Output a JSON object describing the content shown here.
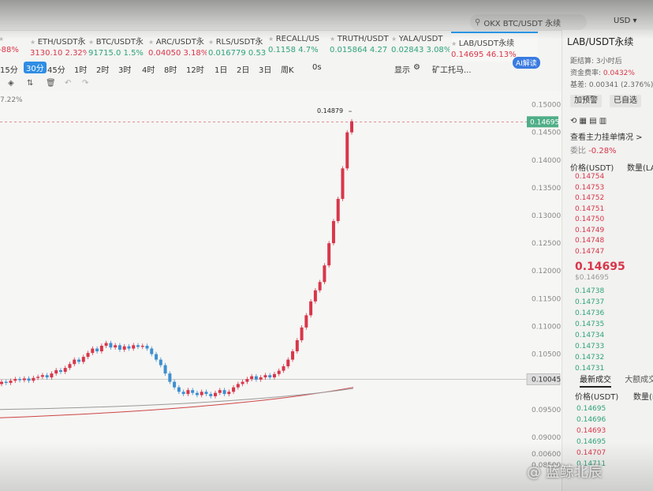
{
  "search": {
    "placeholder": "OKX BTC/USDT 永续"
  },
  "currency": "USD",
  "tickers": [
    {
      "name": "",
      "price": "",
      "change": "-88%",
      "dir": "dn"
    },
    {
      "name": "ETH/USDT永",
      "price": "3130.10",
      "change": "2.32%",
      "dir": "dn"
    },
    {
      "name": "BTC/USDT永",
      "price": "91715.0",
      "change": "1.5%",
      "dir": "up"
    },
    {
      "name": "ARC/USDT永",
      "price": "0.04050",
      "change": "3.18%",
      "dir": "dn"
    },
    {
      "name": "RLS/USDT永",
      "price": "0.016779",
      "change": "0.53",
      "dir": "up"
    },
    {
      "name": "RECALL/US",
      "price": "0.1158",
      "change": "4.7%",
      "dir": "up"
    },
    {
      "name": "TRUTH/USDT",
      "price": "0.015864",
      "change": "4.27",
      "dir": "up"
    },
    {
      "name": "YALA/USDT",
      "price": "0.02843",
      "change": "3.08%",
      "dir": "up"
    },
    {
      "name": "LAB/USDT永续",
      "price": "0.14695",
      "change": "46.13%",
      "dir": "dn"
    }
  ],
  "timeframes": [
    "15分",
    "30分",
    "45分",
    "1时",
    "2时",
    "3时",
    "4时",
    "8时",
    "12时",
    "1日",
    "2日",
    "3日",
    "周K",
    "0s"
  ],
  "selected_timeframe": "30分",
  "display_label": "显示",
  "miner_label": "矿工托马...",
  "ai_badge": "AI解读",
  "chart_change_pct": "7.22%",
  "panel": {
    "title": "LAB/USDT永续",
    "countdown_label": "距结算:",
    "countdown_value": "3小时后",
    "funding_label": "资金费率:",
    "funding_value": "0.0432%",
    "basis_label": "基差:",
    "basis_value": "0.00341 (2.376%)",
    "alert_btn": "加预警",
    "fav_btn": "已自选",
    "depth_link": "查看主力挂单情况 >",
    "ratio_label": "委比",
    "ratio_value": "-0.28%",
    "col_price": "价格(USDT)",
    "col_qty": "数量(LA",
    "asks": [
      "0.14754",
      "0.14753",
      "0.14752",
      "0.14751",
      "0.14750",
      "0.14749",
      "0.14748",
      "0.14747"
    ],
    "last_price": "0.14695",
    "last_usd": "$0.14695",
    "bids": [
      "0.14738",
      "0.14737",
      "0.14736",
      "0.14735",
      "0.14734",
      "0.14733",
      "0.14732",
      "0.14731"
    ],
    "tab_latest": "最新成交",
    "tab_large": "大额成交",
    "trades_col_price": "价格(USDT)",
    "trades_col_qty": "数量(L",
    "trades": [
      {
        "p": "0.14695",
        "dir": "up"
      },
      {
        "p": "0.14696",
        "dir": "up"
      },
      {
        "p": "0.14693",
        "dir": "dn"
      },
      {
        "p": "0.14695",
        "dir": "up"
      },
      {
        "p": "0.14707",
        "dir": "dn"
      },
      {
        "p": "0.14711",
        "dir": "up"
      }
    ]
  },
  "watermark": "@ 蓝鲸北辰",
  "colors": {
    "up": "#2fa37d",
    "down": "#d8364a",
    "accent": "#2f8de4"
  },
  "chart_data": {
    "type": "candlestick",
    "y_ticks": [
      0.15,
      0.145,
      0.14,
      0.135,
      0.13,
      0.125,
      0.12,
      0.115,
      0.11,
      0.105,
      0.1,
      0.095,
      0.09,
      0.085,
      0.006
    ],
    "y_tick_labels": [
      "0.15000",
      "0.14500",
      "0.14000",
      "0.13500",
      "0.13000",
      "0.12500",
      "0.12000",
      "0.11500",
      "0.11000",
      "0.10500",
      "0.10045",
      "0.09500",
      "0.09000",
      "0.08500",
      "0.00600"
    ],
    "ylim": [
      0.081,
      0.153
    ],
    "last_price_label": "0.14695",
    "ref_line_label": "0.10045",
    "high_label": "0.14879",
    "closes": [
      0.1,
      0.0998,
      0.1002,
      0.1005,
      0.1003,
      0.1006,
      0.1002,
      0.1007,
      0.1009,
      0.1012,
      0.1008,
      0.1015,
      0.1021,
      0.1018,
      0.1025,
      0.1032,
      0.104,
      0.1036,
      0.1045,
      0.1052,
      0.106,
      0.1055,
      0.1065,
      0.107,
      0.1062,
      0.1066,
      0.1058,
      0.1064,
      0.106,
      0.1066,
      0.1063,
      0.1065,
      0.106,
      0.105,
      0.104,
      0.103,
      0.1015,
      0.1,
      0.099,
      0.0982,
      0.0978,
      0.0985,
      0.098,
      0.0976,
      0.0982,
      0.0978,
      0.0974,
      0.098,
      0.0985,
      0.0978,
      0.0982,
      0.099,
      0.0996,
      0.1,
      0.1005,
      0.101,
      0.1004,
      0.1008,
      0.1012,
      0.1008,
      0.1014,
      0.102,
      0.1028,
      0.104,
      0.1055,
      0.1075,
      0.1098,
      0.112,
      0.1145,
      0.1165,
      0.118,
      0.121,
      0.125,
      0.129,
      0.133,
      0.1385,
      0.145,
      0.147
    ],
    "ma1": [
      0.095,
      0.0988
    ],
    "ma2": [
      0.0935,
      0.099
    ]
  }
}
